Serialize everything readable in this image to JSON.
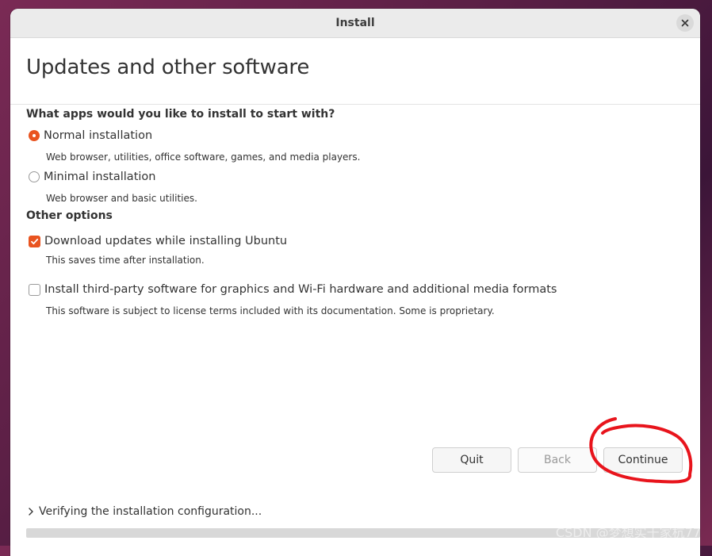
{
  "window": {
    "title": "Install"
  },
  "page": {
    "title": "Updates and other software"
  },
  "apps_section": {
    "heading": "What apps would you like to install to start with?",
    "options": [
      {
        "label": "Normal installation",
        "description": "Web browser, utilities, office software, games, and media players.",
        "selected": true
      },
      {
        "label": "Minimal installation",
        "description": "Web browser and basic utilities.",
        "selected": false
      }
    ]
  },
  "other_section": {
    "heading": "Other options",
    "options": [
      {
        "label": "Download updates while installing Ubuntu",
        "description": "This saves time after installation.",
        "checked": true
      },
      {
        "label": "Install third-party software for graphics and Wi-Fi hardware and additional media formats",
        "description": "This software is subject to license terms included with its documentation. Some is proprietary.",
        "checked": false
      }
    ]
  },
  "buttons": {
    "quit": "Quit",
    "back": "Back",
    "continue": "Continue"
  },
  "status": {
    "text": "Verifying the installation configuration...",
    "progress": 0
  },
  "watermark": "CSDN @梦想实干家杭77",
  "colors": {
    "accent": "#e95420",
    "annotation": "#e8141c"
  }
}
